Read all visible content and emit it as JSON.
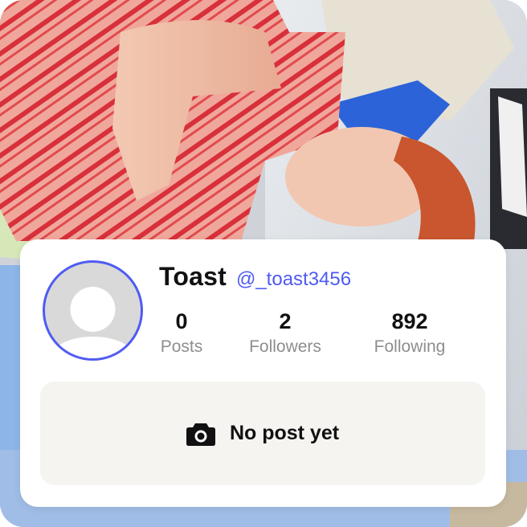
{
  "profile": {
    "display_name": "Toast",
    "handle": "@_toast3456",
    "avatar_icon": "default-user-silhouette"
  },
  "stats": [
    {
      "value": "0",
      "label": "Posts"
    },
    {
      "value": "2",
      "label": "Followers"
    },
    {
      "value": "892",
      "label": "Following"
    }
  ],
  "posts_empty": {
    "icon": "camera-icon",
    "message": "No post yet"
  },
  "colors": {
    "accent": "#4f5bf2",
    "card_bg": "#ffffff",
    "empty_bg": "#f5f4f1",
    "muted_text": "#8e8e8e"
  }
}
